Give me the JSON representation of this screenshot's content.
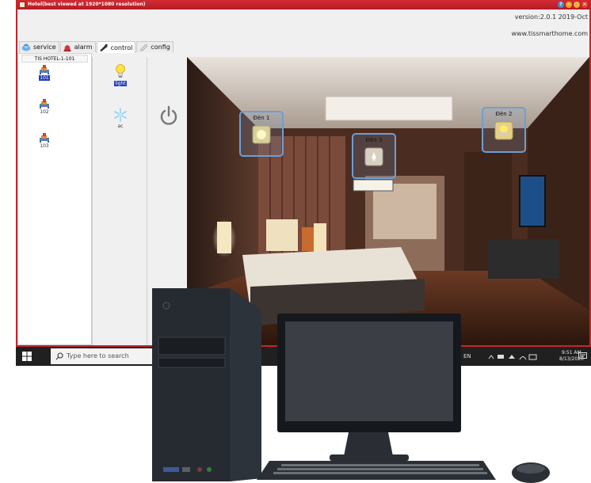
{
  "window": {
    "title": "Hotel(best viewed at 1920*1080 resolution)",
    "version": "version:2.0.1 2019-Oct",
    "website": "www.tissmarthome.com",
    "accent": "#c8242c"
  },
  "tabs": [
    {
      "label": "service",
      "icon": "earth-icon"
    },
    {
      "label": "alarm",
      "icon": "alarm-icon"
    },
    {
      "label": "control",
      "icon": "wrench-icon",
      "active": true
    },
    {
      "label": "config",
      "icon": "pencil-icon"
    }
  ],
  "rooms_panel": {
    "header": "TIS HOTEL-1-101",
    "rooms": [
      {
        "label": "101",
        "selected": true
      },
      {
        "label": "102",
        "selected": false
      },
      {
        "label": "103",
        "selected": false
      }
    ]
  },
  "devices": [
    {
      "label": "light",
      "icon": "lightbulb-icon",
      "selected": true
    },
    {
      "label": "ac",
      "icon": "snowflake-icon",
      "selected": false
    }
  ],
  "scene": {
    "lamps": [
      {
        "label": "Đèn 1",
        "state": "on"
      },
      {
        "label": "Đèn 3",
        "state": "off"
      },
      {
        "label": "Đèn 2",
        "state": "on"
      }
    ]
  },
  "taskbar": {
    "search_placeholder": "Type here to search",
    "language": "EN",
    "time": "9:51 AM",
    "date": "8/13/2020"
  }
}
